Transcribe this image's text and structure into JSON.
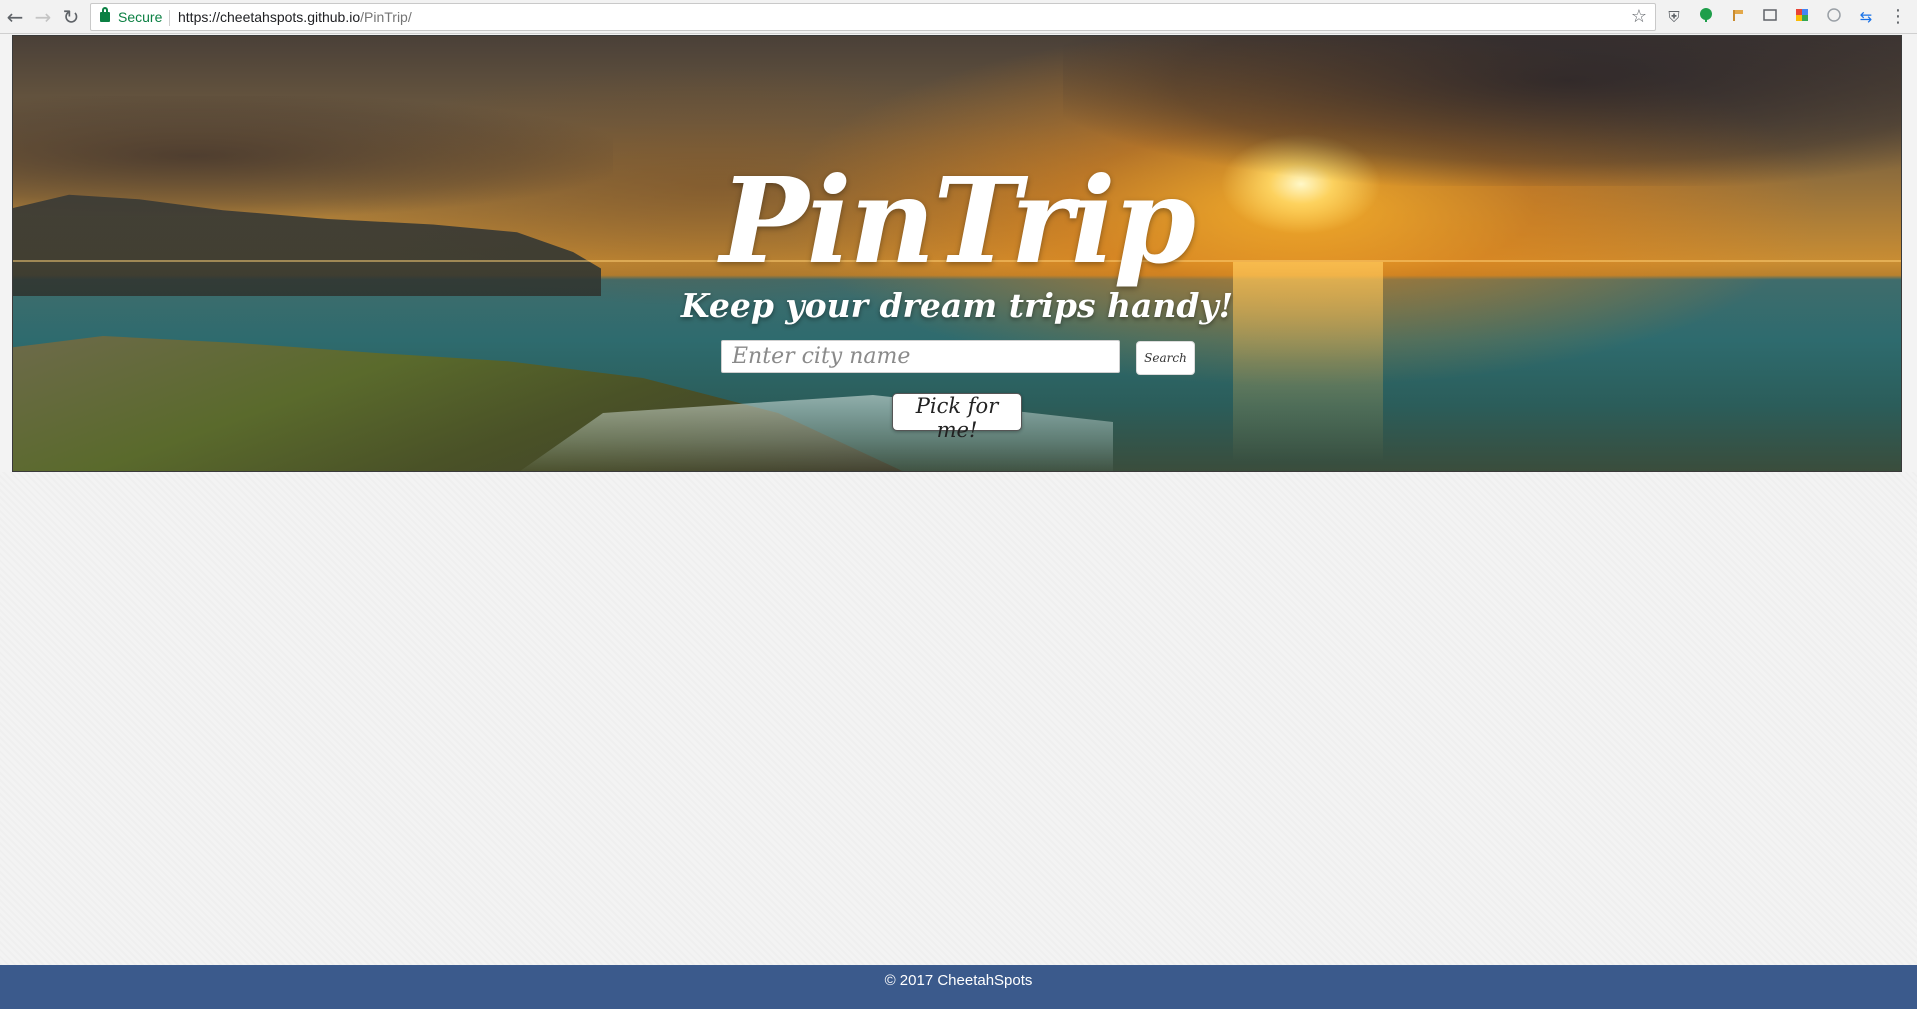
{
  "browser": {
    "secure_label": "Secure",
    "url_host": "https://cheetahspots.github.io",
    "url_path": "/PinTrip/",
    "icons": [
      "back-arrow-icon",
      "forward-arrow-icon",
      "reload-icon",
      "lock-icon",
      "star-icon",
      "shield-extension-icon",
      "green-leaf-extension-icon",
      "flag-extension-icon",
      "screen-capture-extension-icon",
      "colorful-extension-icon",
      "circle-extension-icon",
      "arrows-extension-icon",
      "menu-kebab-icon"
    ]
  },
  "hero": {
    "title": "PinTrip",
    "subtitle": "Keep your dream trips handy!",
    "search_placeholder": "Enter city name",
    "search_button": "Search",
    "pick_button": "Pick for me!"
  },
  "footer": {
    "text": "© 2017 CheetahSpots"
  },
  "colors": {
    "footer_bg": "#3b5a8c",
    "secure_green": "#0b8043",
    "page_bg": "#f3f3f3"
  }
}
